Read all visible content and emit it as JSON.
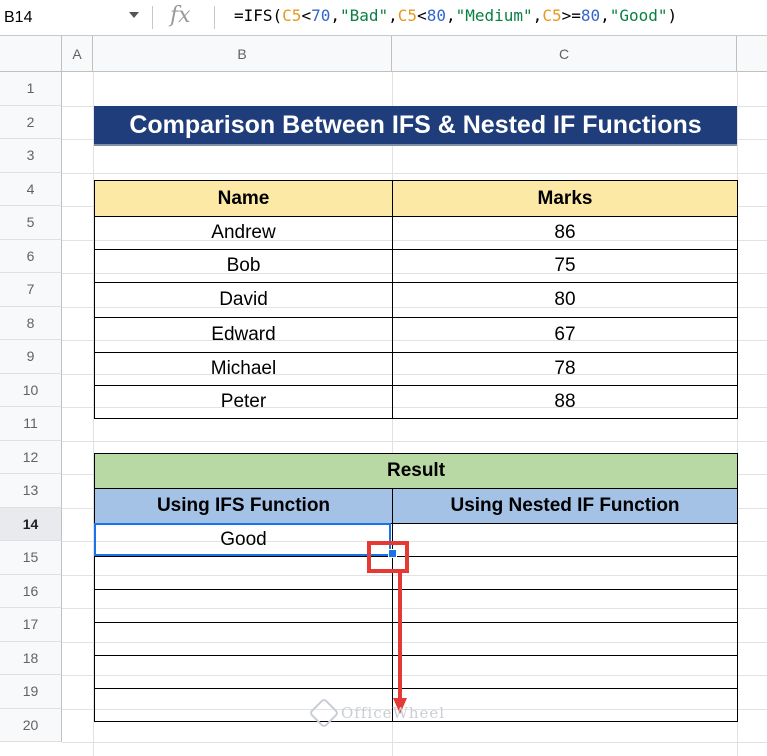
{
  "formula_bar": {
    "name_box": "B14",
    "fx_label": "fx",
    "formula_parts": [
      {
        "t": "=IFS(",
        "c": "plain"
      },
      {
        "t": "C5",
        "c": "ref"
      },
      {
        "t": "<",
        "c": "plain"
      },
      {
        "t": "70",
        "c": "num"
      },
      {
        "t": ",",
        "c": "plain"
      },
      {
        "t": "\"Bad\"",
        "c": "str"
      },
      {
        "t": ",",
        "c": "plain"
      },
      {
        "t": "C5",
        "c": "ref"
      },
      {
        "t": "<",
        "c": "plain"
      },
      {
        "t": "80",
        "c": "num"
      },
      {
        "t": ",",
        "c": "plain"
      },
      {
        "t": "\"Medium\"",
        "c": "str"
      },
      {
        "t": ",",
        "c": "plain"
      },
      {
        "t": "C5",
        "c": "ref"
      },
      {
        "t": ">=",
        "c": "plain"
      },
      {
        "t": "80",
        "c": "num"
      },
      {
        "t": ",",
        "c": "plain"
      },
      {
        "t": "\"Good\"",
        "c": "str"
      },
      {
        "t": ")",
        "c": "plain"
      }
    ]
  },
  "columns": [
    "A",
    "B",
    "C"
  ],
  "rows": [
    "1",
    "2",
    "3",
    "4",
    "5",
    "6",
    "7",
    "8",
    "9",
    "10",
    "11",
    "12",
    "13",
    "14",
    "15",
    "16",
    "17",
    "18",
    "19",
    "20"
  ],
  "selected_row": "14",
  "title": "Comparison Between IFS & Nested IF Functions",
  "data_table": {
    "headers": [
      "Name",
      "Marks"
    ],
    "rows": [
      [
        "Andrew",
        "86"
      ],
      [
        "Bob",
        "75"
      ],
      [
        "David",
        "80"
      ],
      [
        "Edward",
        "67"
      ],
      [
        "Michael",
        "78"
      ],
      [
        "Peter",
        "88"
      ]
    ]
  },
  "result_table": {
    "title": "Result",
    "headers": [
      "Using IFS Function",
      "Using Nested IF Function"
    ],
    "rows": [
      [
        "Good",
        ""
      ],
      [
        "",
        ""
      ],
      [
        "",
        ""
      ],
      [
        "",
        ""
      ],
      [
        "",
        ""
      ],
      [
        "",
        ""
      ]
    ]
  },
  "watermark": "OfficeWheel",
  "colors": {
    "title_bg": "#1f3d7a",
    "header_yellow": "#fde9a6",
    "header_green": "#b8d8a4",
    "header_blue": "#a4c2e6",
    "selection": "#1a73e8",
    "annotation_red": "#e53935"
  }
}
